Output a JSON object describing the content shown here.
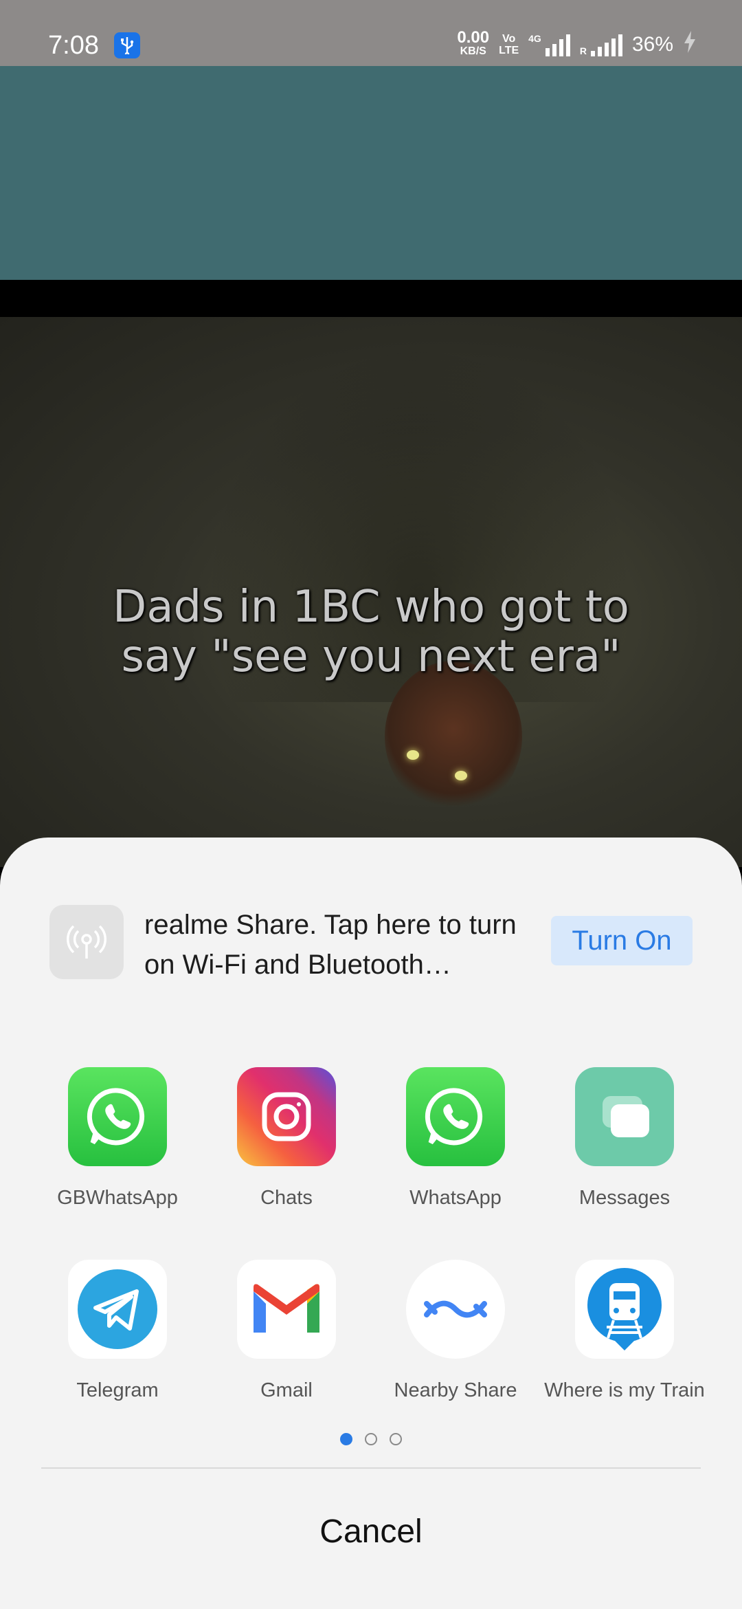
{
  "status_bar": {
    "time": "7:08",
    "speed_value": "0.00",
    "speed_unit": "KB/S",
    "volte_top": "VoLTE",
    "volte_label1": "Vo",
    "volte_label2": "LTE",
    "net_type": "4G",
    "roaming": "R",
    "battery": "36%"
  },
  "meme": {
    "caption_line1": "Dads in 1BC who got to",
    "caption_line2": "say \"see you next era\""
  },
  "share_sheet": {
    "realme_share_text": "realme Share. Tap here to turn on Wi-Fi and Bluetooth…",
    "turn_on_label": "Turn On",
    "apps": [
      {
        "label": "GBWhatsApp",
        "icon": "whatsapp-icon"
      },
      {
        "label": "Chats",
        "icon": "instagram-icon"
      },
      {
        "label": "WhatsApp",
        "icon": "whatsapp-icon"
      },
      {
        "label": "Messages",
        "icon": "messages-icon"
      },
      {
        "label": "Telegram",
        "icon": "telegram-icon"
      },
      {
        "label": "Gmail",
        "icon": "gmail-icon"
      },
      {
        "label": "Nearby Share",
        "icon": "nearby-share-icon"
      },
      {
        "label": "Where is my Train",
        "icon": "train-icon"
      }
    ],
    "page_count": 3,
    "active_page": 1,
    "cancel_label": "Cancel"
  },
  "colors": {
    "accent": "#2a7be4",
    "whatsapp": "#27c03f",
    "telegram": "#2ca5e0",
    "messages": "#6dcaa9"
  }
}
